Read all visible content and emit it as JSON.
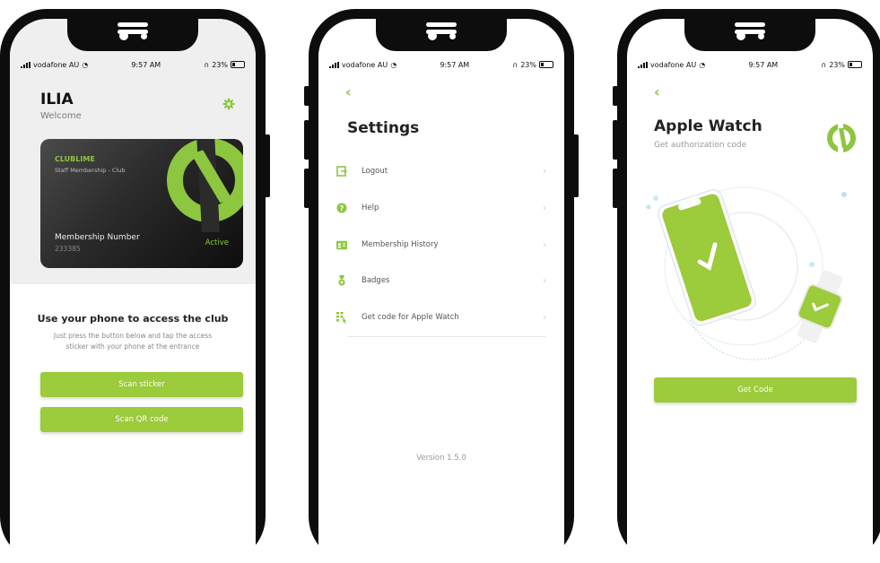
{
  "statusbar": {
    "carrier": "vodafone AU",
    "time": "9:57 AM",
    "battery": "23%"
  },
  "home": {
    "user_name": "ILIA",
    "welcome": "Welcome",
    "card": {
      "brand_prefix": "CLUB",
      "brand_suffix": "LIME",
      "membership_type": "Staff Membership - Club",
      "number_label": "Membership Number",
      "number": "233385",
      "status": "Active"
    },
    "access_title": "Use your phone to access the club",
    "access_desc_line1": "Just press the button below and tap the access",
    "access_desc_line2": "sticker with your phone at the entrance",
    "scan_sticker": "Scan sticker",
    "scan_qr": "Scan QR code"
  },
  "settings": {
    "title": "Settings",
    "items": [
      {
        "label": "Logout",
        "icon": "logout-icon"
      },
      {
        "label": "Help",
        "icon": "help-icon"
      },
      {
        "label": "Membership History",
        "icon": "id-card-icon"
      },
      {
        "label": "Badges",
        "icon": "medal-icon"
      },
      {
        "label": "Get code for Apple Watch",
        "icon": "keypad-icon"
      }
    ],
    "version": "Version 1.5.0"
  },
  "watch": {
    "title": "Apple Watch",
    "subtitle": "Get authorization code",
    "get_code": "Get Code"
  },
  "colors": {
    "accent": "#9ccb3b",
    "dark": "#0d0d0d"
  }
}
